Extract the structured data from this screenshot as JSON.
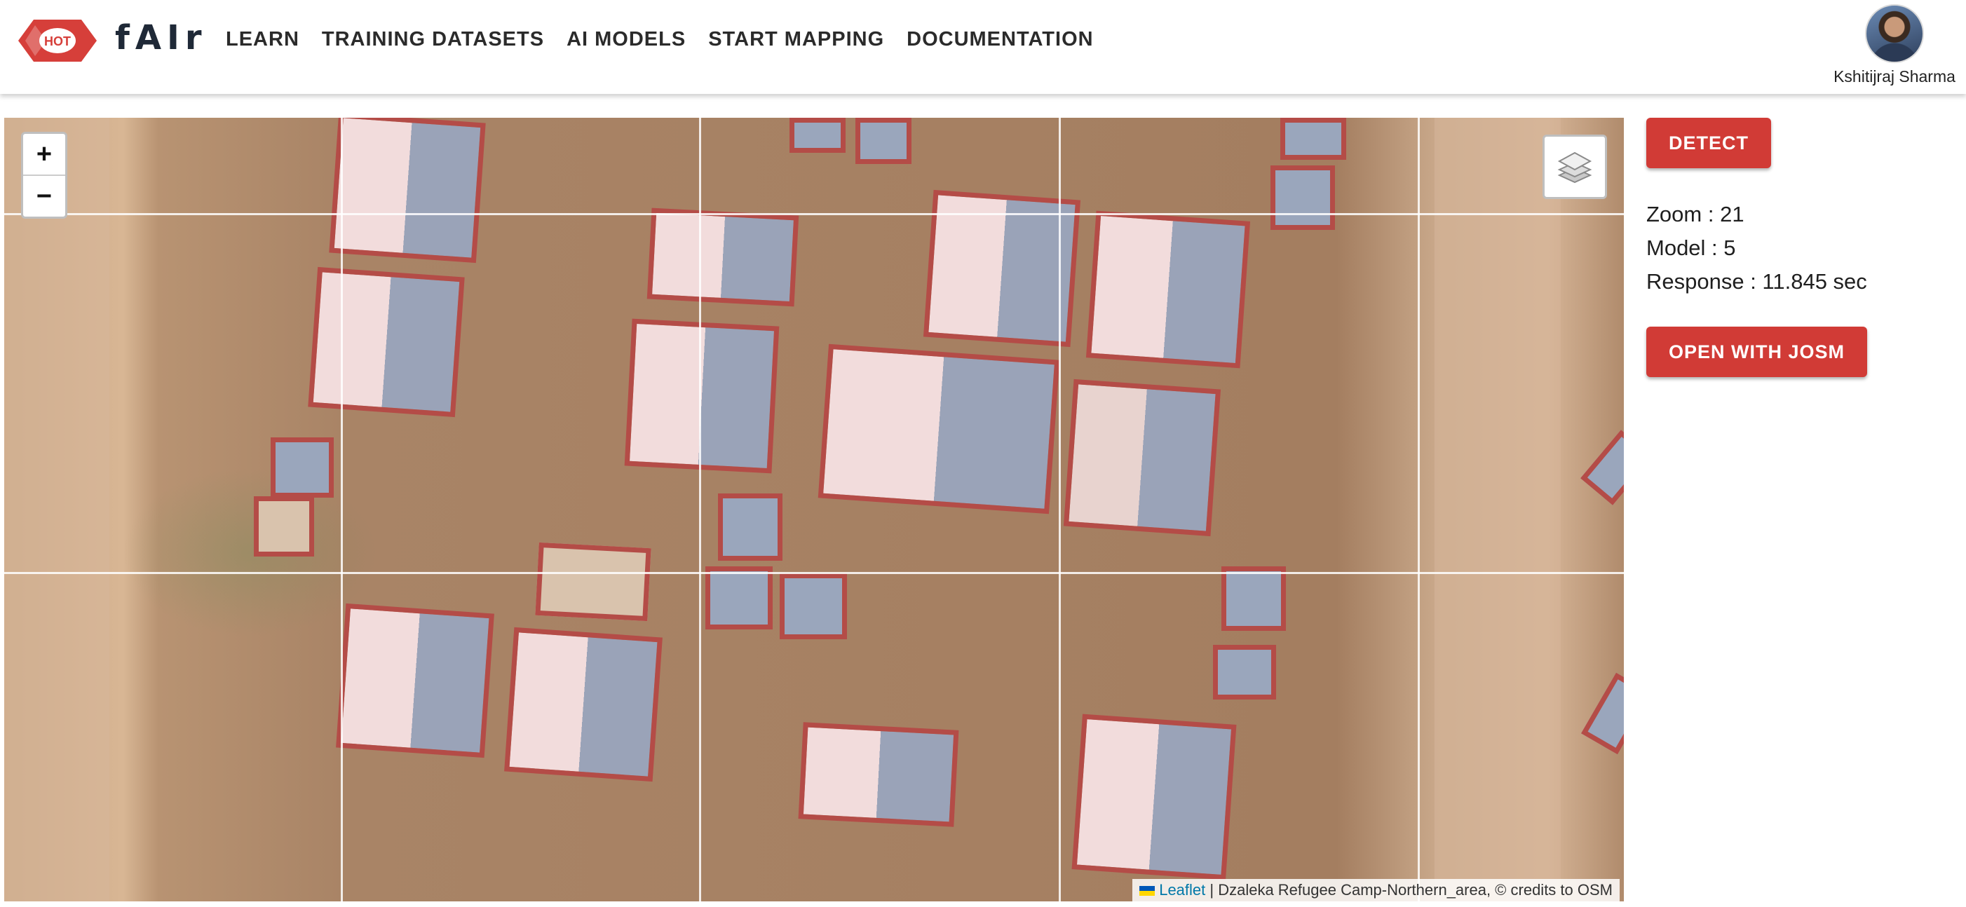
{
  "header": {
    "logo_text": "HOT",
    "brand": "fAIr",
    "nav": [
      "LEARN",
      "TRAINING DATASETS",
      "AI MODELS",
      "START MAPPING",
      "DOCUMENTATION"
    ],
    "user_name": "Kshitijraj Sharma"
  },
  "map": {
    "zoom_in": "+",
    "zoom_out": "−",
    "attribution_link": "Leaflet",
    "attribution_text": " | Dzaleka Refugee Camp-Northern_area, © credits to OSM"
  },
  "panel": {
    "detect_label": "DETECT",
    "zoom_line": "Zoom : 21",
    "model_line": "Model : 5",
    "response_line": "Response : 11.845 sec",
    "josm_label": "OPEN WITH JOSM"
  },
  "colors": {
    "accent": "#d13b36",
    "prediction_outline": "#b44c47"
  }
}
